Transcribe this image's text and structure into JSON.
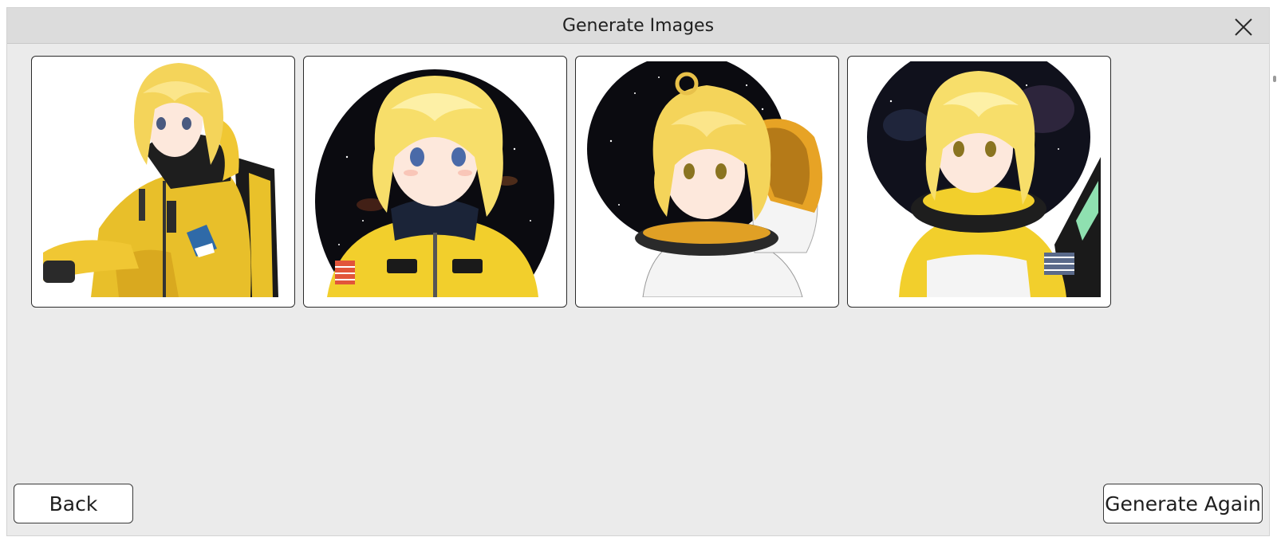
{
  "dialog": {
    "title": "Generate Images",
    "close_icon": "close-icon"
  },
  "images": [
    {
      "subject": "anime-girl-yellow-spacesuit-seated"
    },
    {
      "subject": "anime-girl-yellow-spacesuit-starfield"
    },
    {
      "subject": "anime-girl-white-spacesuit-helmet"
    },
    {
      "subject": "anime-girl-yellow-spacesuit-galaxy"
    }
  ],
  "buttons": {
    "back": "Back",
    "generate_again": "Generate Again"
  },
  "colors": {
    "dialog_bg": "#ebebeb",
    "titlebar_bg": "#dcdcdc",
    "suit_yellow": "#f2cf2c",
    "hair_blonde": "#f7de6a",
    "space_black": "#0b0b10"
  }
}
